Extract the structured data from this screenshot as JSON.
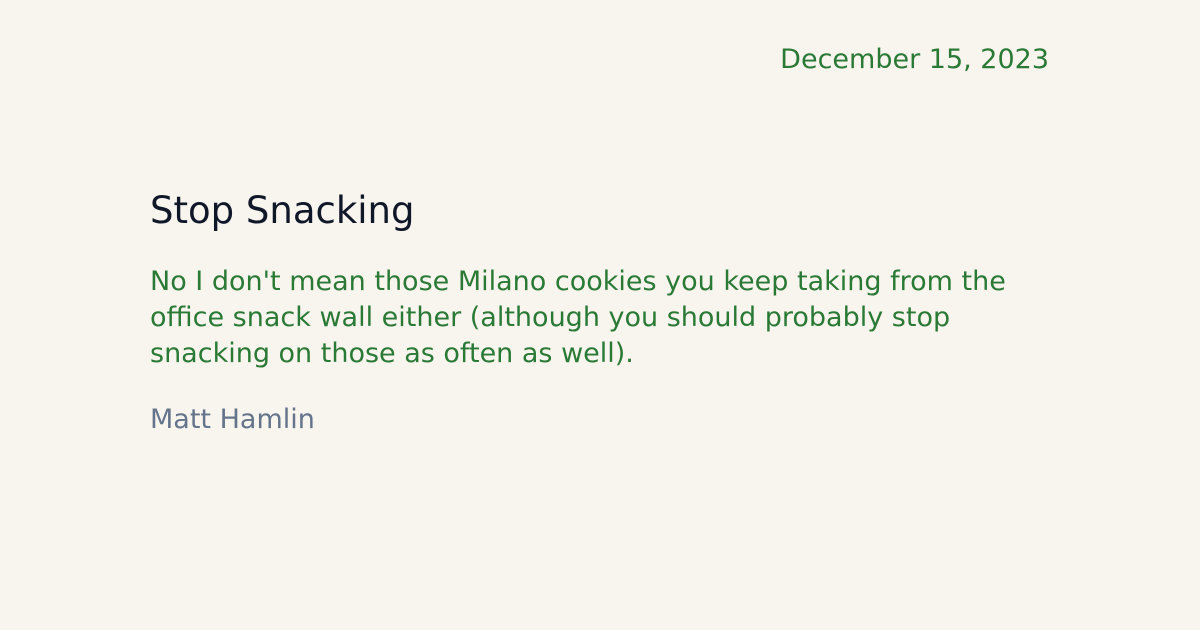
{
  "post": {
    "date": "December 15, 2023",
    "title": "Stop Snacking",
    "excerpt": "No I don't mean those Milano cookies you keep taking from the office snack wall either (although you should probably stop snacking on those as often as well).",
    "author": "Matt Hamlin"
  },
  "colors": {
    "background": "#f8f4ee",
    "accent_green": "#2a7a36",
    "title": "#0f1729",
    "author": "#64748b"
  }
}
